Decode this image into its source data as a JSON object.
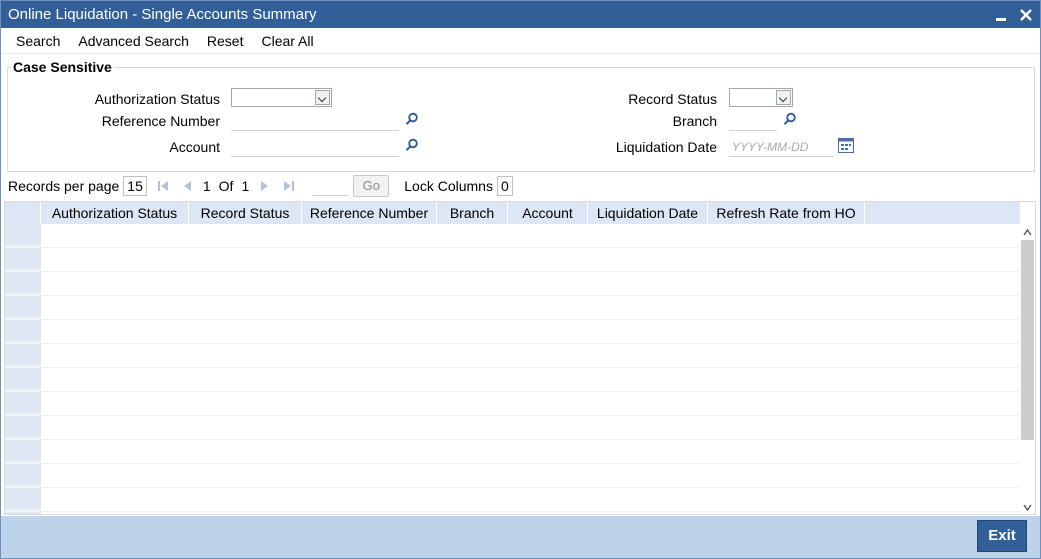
{
  "window": {
    "title": "Online Liquidation - Single Accounts Summary"
  },
  "toolbar": {
    "search": "Search",
    "advanced_search": "Advanced Search",
    "reset": "Reset",
    "clear_all": "Clear All"
  },
  "criteria": {
    "legend": "Case Sensitive",
    "authorization_status_label": "Authorization Status",
    "authorization_status_value": "",
    "reference_number_label": "Reference Number",
    "reference_number_value": "",
    "account_label": "Account",
    "account_value": "",
    "record_status_label": "Record Status",
    "record_status_value": "",
    "branch_label": "Branch",
    "branch_value": "",
    "liquidation_date_label": "Liquidation Date",
    "liquidation_date_placeholder": "YYYY-MM-DD"
  },
  "pager": {
    "records_per_page_label": "Records per page",
    "records_per_page": "15",
    "current_page": "1",
    "of_label": "Of",
    "total_pages": "1",
    "go_label": "Go",
    "lock_columns_label": "Lock Columns",
    "lock_columns_value": "0"
  },
  "grid": {
    "columns": [
      "Authorization Status",
      "Record Status",
      "Reference Number",
      "Branch",
      "Account",
      "Liquidation Date",
      "Refresh Rate from HO"
    ]
  },
  "footer": {
    "exit_label": "Exit"
  },
  "colors": {
    "title_bar": "#335f99",
    "header_row": "#dce6f4",
    "footer": "#bdd3ea"
  }
}
